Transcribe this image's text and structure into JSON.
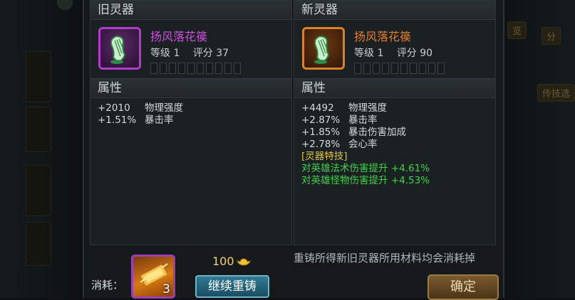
{
  "background": {
    "right_button_1": "览",
    "right_button_2": "分",
    "right_button_3": "传技选"
  },
  "old_panel": {
    "title": "旧灵器",
    "item": {
      "name": "扬风落花篌",
      "level_label": "等级 1",
      "score_label": "评分 37",
      "rarity_color": "#cf4fe3",
      "icon": "harp-icon",
      "star_slots": 10
    },
    "attr_title": "属性",
    "attributes": [
      {
        "value": "+2010",
        "name": "物理强度"
      },
      {
        "value": "+1.51%",
        "name": "暴击率"
      }
    ]
  },
  "new_panel": {
    "title": "新灵器",
    "item": {
      "name": "扬风落花篌",
      "level_label": "等级 1",
      "score_label": "评分 90",
      "rarity_color": "#e67f2a",
      "icon": "harp-icon",
      "star_slots": 10
    },
    "attr_title": "属性",
    "attributes": [
      {
        "value": "+4492",
        "name": "物理强度"
      },
      {
        "value": "+2.87%",
        "name": "暴击率"
      },
      {
        "value": "+1.85%",
        "name": "暴击伤害加成"
      },
      {
        "value": "+2.78%",
        "name": "会心率"
      }
    ],
    "skill_title": "[灵器特技]",
    "skills": [
      "对英雄法术伤害提升 +4.61%",
      "对英雄怪物伤害提升 +4.53%"
    ]
  },
  "footer": {
    "consume_label": "消耗：",
    "material_count": "3",
    "material_icon": "gold-scroll-icon",
    "cost_amount": "100",
    "cost_icon": "gold-ingot-icon",
    "reforge_button": "继续重铸",
    "notice": "重铸所得新旧灵器所用材料均会消耗掉",
    "confirm_button": "确定"
  },
  "colors": {
    "purple_quality": "#b03bc9",
    "orange_quality": "#d9822b",
    "skill_green": "#3fd34a",
    "skill_title_yellow": "#e0c43a"
  }
}
